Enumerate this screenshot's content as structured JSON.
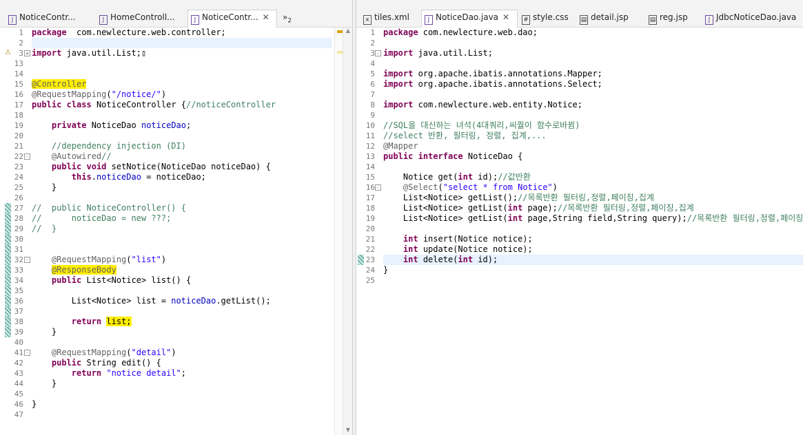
{
  "left": {
    "tabs": [
      {
        "label": "NoticeContr...",
        "icon": "java-file-icon",
        "active": false
      },
      {
        "label": "HomeControll...",
        "icon": "java-file-icon",
        "active": false
      },
      {
        "label": "NoticeContr...",
        "icon": "java-file-icon",
        "active": true
      }
    ],
    "overflow_label": "»",
    "overflow_count": "2",
    "lines": [
      {
        "n": "1",
        "tokens": [
          [
            "kw",
            "package"
          ],
          [
            "",
            "  com.newlecture.web.controller;"
          ]
        ]
      },
      {
        "n": "2",
        "tokens": [],
        "current": true
      },
      {
        "n": "3",
        "fold": "+",
        "warn": true,
        "tokens": [
          [
            "kw",
            "import"
          ],
          [
            "",
            " java.util.List;"
          ],
          [
            "",
            "▯"
          ]
        ]
      },
      {
        "n": "13",
        "tokens": []
      },
      {
        "n": "14",
        "tokens": []
      },
      {
        "n": "15",
        "tokens": [
          [
            "an hl",
            "@Controller"
          ]
        ]
      },
      {
        "n": "16",
        "tokens": [
          [
            "an",
            "@RequestMapping"
          ],
          [
            "",
            "("
          ],
          [
            "str",
            "\"/notice/\""
          ],
          [
            "",
            ")"
          ]
        ]
      },
      {
        "n": "17",
        "tokens": [
          [
            "kw",
            "public"
          ],
          [
            "",
            " "
          ],
          [
            "kw",
            "class"
          ],
          [
            "",
            " NoticeController {"
          ],
          [
            "cm",
            "//noticeController"
          ]
        ]
      },
      {
        "n": "18",
        "tokens": []
      },
      {
        "n": "19",
        "tokens": [
          [
            "",
            "    "
          ],
          [
            "kw",
            "private"
          ],
          [
            "",
            " NoticeDao "
          ],
          [
            "fld",
            "noticeDao"
          ],
          [
            "",
            ";"
          ]
        ]
      },
      {
        "n": "20",
        "tokens": []
      },
      {
        "n": "21",
        "tokens": [
          [
            "",
            "    "
          ],
          [
            "cm",
            "//dependency injection (DI)"
          ]
        ]
      },
      {
        "n": "22",
        "fold": "-",
        "tokens": [
          [
            "",
            "    "
          ],
          [
            "an",
            "@Autowired"
          ],
          [
            "cm",
            "//"
          ]
        ]
      },
      {
        "n": "23",
        "tokens": [
          [
            "",
            "    "
          ],
          [
            "kw",
            "public"
          ],
          [
            "",
            " "
          ],
          [
            "kw",
            "void"
          ],
          [
            "",
            " setNotice(NoticeDao noticeDao) {"
          ]
        ]
      },
      {
        "n": "24",
        "tokens": [
          [
            "",
            "        "
          ],
          [
            "kw",
            "this"
          ],
          [
            "",
            "."
          ],
          [
            "fld",
            "noticeDao"
          ],
          [
            "",
            " = noticeDao;"
          ]
        ]
      },
      {
        "n": "25",
        "tokens": [
          [
            "",
            "    }"
          ]
        ]
      },
      {
        "n": "26",
        "tokens": []
      },
      {
        "n": "27",
        "mark": true,
        "tokens": [
          [
            "cm",
            "//  public NoticeController() {"
          ]
        ]
      },
      {
        "n": "28",
        "mark": true,
        "tokens": [
          [
            "cm",
            "//      noticeDao = new ???;"
          ]
        ]
      },
      {
        "n": "29",
        "mark": true,
        "tokens": [
          [
            "cm",
            "//  }"
          ]
        ]
      },
      {
        "n": "30",
        "mark": true,
        "tokens": []
      },
      {
        "n": "31",
        "mark": true,
        "tokens": []
      },
      {
        "n": "32",
        "mark": true,
        "fold": "-",
        "tokens": [
          [
            "",
            "    "
          ],
          [
            "an",
            "@RequestMapping"
          ],
          [
            "",
            "("
          ],
          [
            "str",
            "\"list\""
          ],
          [
            "",
            ")"
          ]
        ]
      },
      {
        "n": "33",
        "mark": true,
        "tokens": [
          [
            "",
            "    "
          ],
          [
            "an hl",
            "@ResponseBody"
          ]
        ]
      },
      {
        "n": "34",
        "mark": true,
        "tokens": [
          [
            "",
            "    "
          ],
          [
            "kw",
            "public"
          ],
          [
            "",
            " List<Notice> list() {"
          ]
        ]
      },
      {
        "n": "35",
        "mark": true,
        "tokens": []
      },
      {
        "n": "36",
        "mark": true,
        "tokens": [
          [
            "",
            "        List<Notice> list = "
          ],
          [
            "fld",
            "noticeDao"
          ],
          [
            "",
            ".getList();"
          ]
        ]
      },
      {
        "n": "37",
        "mark": true,
        "tokens": []
      },
      {
        "n": "38",
        "mark": true,
        "tokens": [
          [
            "",
            "        "
          ],
          [
            "kw",
            "return"
          ],
          [
            "",
            " "
          ],
          [
            "hl",
            "list;"
          ]
        ]
      },
      {
        "n": "39",
        "mark": true,
        "tokens": [
          [
            "",
            "    }"
          ]
        ]
      },
      {
        "n": "40",
        "tokens": []
      },
      {
        "n": "41",
        "fold": "-",
        "tokens": [
          [
            "",
            "    "
          ],
          [
            "an",
            "@RequestMapping"
          ],
          [
            "",
            "("
          ],
          [
            "str",
            "\"detail\""
          ],
          [
            "",
            ")"
          ]
        ]
      },
      {
        "n": "42",
        "tokens": [
          [
            "",
            "    "
          ],
          [
            "kw",
            "public"
          ],
          [
            "",
            " String edit() {"
          ]
        ]
      },
      {
        "n": "43",
        "tokens": [
          [
            "",
            "        "
          ],
          [
            "kw",
            "return"
          ],
          [
            "",
            " "
          ],
          [
            "str",
            "\"notice detail\""
          ],
          [
            "",
            ";"
          ]
        ]
      },
      {
        "n": "44",
        "tokens": [
          [
            "",
            "    }"
          ]
        ]
      },
      {
        "n": "45",
        "tokens": []
      },
      {
        "n": "46",
        "tokens": [
          [
            "",
            "}"
          ]
        ]
      },
      {
        "n": "47",
        "tokens": []
      }
    ]
  },
  "right": {
    "tabs": [
      {
        "label": "tiles.xml",
        "icon": "xml-file-icon",
        "active": false
      },
      {
        "label": "NoticeDao.java",
        "icon": "java-file-icon",
        "active": true
      },
      {
        "label": "style.css",
        "icon": "css-file-icon",
        "active": false
      },
      {
        "label": "detail.jsp",
        "icon": "jsp-file-icon",
        "active": false
      },
      {
        "label": "reg.jsp",
        "icon": "jsp-file-icon",
        "active": false
      },
      {
        "label": "JdbcNoticeDao.java",
        "icon": "java-file-icon",
        "active": false
      }
    ],
    "lines": [
      {
        "n": "1",
        "tokens": [
          [
            "kw",
            "package"
          ],
          [
            "",
            " com.newlecture.web.dao;"
          ]
        ]
      },
      {
        "n": "2",
        "tokens": []
      },
      {
        "n": "3",
        "fold": "-",
        "tokens": [
          [
            "kw",
            "import"
          ],
          [
            "",
            " java.util.List;"
          ]
        ]
      },
      {
        "n": "4",
        "tokens": []
      },
      {
        "n": "5",
        "tokens": [
          [
            "kw",
            "import"
          ],
          [
            "",
            " org.apache.ibatis.annotations.Mapper;"
          ]
        ]
      },
      {
        "n": "6",
        "tokens": [
          [
            "kw",
            "import"
          ],
          [
            "",
            " org.apache.ibatis.annotations.Select;"
          ]
        ]
      },
      {
        "n": "7",
        "tokens": []
      },
      {
        "n": "8",
        "tokens": [
          [
            "kw",
            "import"
          ],
          [
            "",
            " com.newlecture.web.entity.Notice;"
          ]
        ]
      },
      {
        "n": "9",
        "tokens": []
      },
      {
        "n": "10",
        "tokens": [
          [
            "cm",
            "//SQL을 대신하는 녀석(4대쿼리,씨퀄이 함수로바뀜)"
          ]
        ]
      },
      {
        "n": "11",
        "tokens": [
          [
            "cm",
            "//select 반환, 필터링, 정렬, 집계,..."
          ]
        ]
      },
      {
        "n": "12",
        "tokens": [
          [
            "an",
            "@Mapper"
          ]
        ]
      },
      {
        "n": "13",
        "tokens": [
          [
            "kw",
            "public"
          ],
          [
            "",
            " "
          ],
          [
            "kw",
            "interface"
          ],
          [
            "",
            " NoticeDao {"
          ]
        ]
      },
      {
        "n": "14",
        "tokens": []
      },
      {
        "n": "15",
        "tokens": [
          [
            "",
            "    Notice get("
          ],
          [
            "kw",
            "int"
          ],
          [
            "",
            " id);"
          ],
          [
            "cm",
            "//값반환"
          ]
        ]
      },
      {
        "n": "16",
        "fold": "-",
        "tokens": [
          [
            "",
            "    "
          ],
          [
            "an",
            "@Select"
          ],
          [
            "",
            "("
          ],
          [
            "str",
            "\"select * from Notice\""
          ],
          [
            "",
            ")"
          ]
        ]
      },
      {
        "n": "17",
        "tokens": [
          [
            "",
            "    List<Notice> getList();"
          ],
          [
            "cm",
            "//목록반환 필터링,정렬,페이징,집계"
          ]
        ]
      },
      {
        "n": "18",
        "tokens": [
          [
            "",
            "    List<Notice> getList("
          ],
          [
            "kw",
            "int"
          ],
          [
            "",
            " page);"
          ],
          [
            "cm",
            "//목록반환 필터링,정렬,페이징,집계"
          ]
        ]
      },
      {
        "n": "19",
        "tokens": [
          [
            "",
            "    List<Notice> getList("
          ],
          [
            "kw",
            "int"
          ],
          [
            "",
            " page,String field,String query);"
          ],
          [
            "cm",
            "//목록반환 필터링,정렬,페이징,집계"
          ]
        ]
      },
      {
        "n": "20",
        "tokens": []
      },
      {
        "n": "21",
        "tokens": [
          [
            "",
            "    "
          ],
          [
            "kw",
            "int"
          ],
          [
            "",
            " insert(Notice notice);"
          ]
        ]
      },
      {
        "n": "22",
        "tokens": [
          [
            "",
            "    "
          ],
          [
            "kw",
            "int"
          ],
          [
            "",
            " update(Notice notice);"
          ]
        ]
      },
      {
        "n": "23",
        "current": true,
        "mark": true,
        "tokens": [
          [
            "",
            "    "
          ],
          [
            "kw",
            "int"
          ],
          [
            "",
            " delete("
          ],
          [
            "kw",
            "int"
          ],
          [
            "",
            " id);"
          ]
        ]
      },
      {
        "n": "24",
        "tokens": [
          [
            "",
            "}"
          ]
        ]
      },
      {
        "n": "25",
        "tokens": []
      }
    ]
  }
}
